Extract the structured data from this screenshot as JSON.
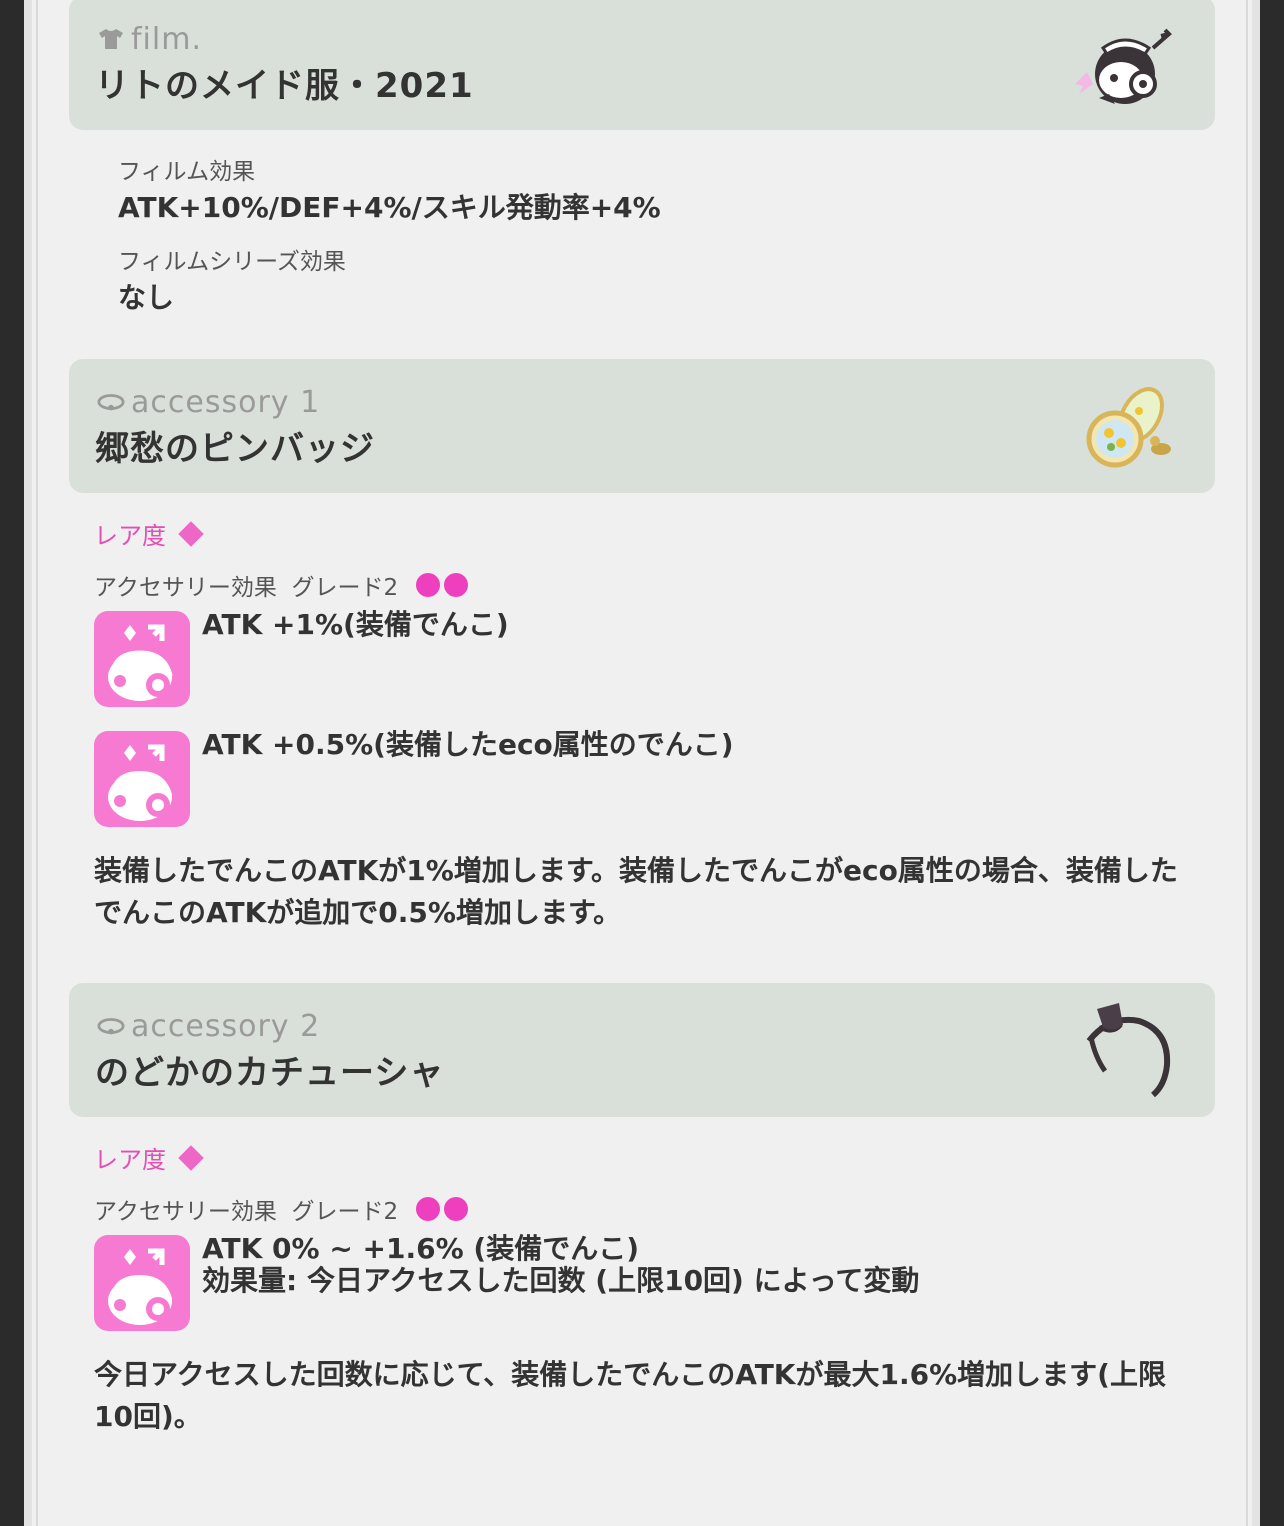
{
  "film": {
    "kind_label": "film.",
    "kind_icon": "tshirt-icon",
    "title": "リトのメイド服・2021",
    "thumb_icon": "maid-character-icon",
    "effect_label": "フィルム効果",
    "effect_value": "ATK+10%/DEF+4%/スキル発動率+4%",
    "series_label": "フィルムシリーズ効果",
    "series_value": "なし"
  },
  "accessory1": {
    "kind_label": "accessory 1",
    "kind_icon": "accessory-icon",
    "title": "郷愁のピンバッジ",
    "thumb_icon": "sunflower-pin-badge-icon",
    "rarity_label": "レア度",
    "grade_label": "アクセサリー効果  グレード2",
    "effects": [
      {
        "text": "ATK +1%(装備でんこ)"
      },
      {
        "text": "ATK +0.5%(装備したeco属性のでんこ)"
      }
    ],
    "description": "装備したでんこのATKが1%増加します。装備したでんこがeco属性の場合、装備したでんこのATKが追加で0.5%増加します。"
  },
  "accessory2": {
    "kind_label": "accessory 2",
    "kind_icon": "accessory-icon",
    "title": "のどかのカチューシャ",
    "thumb_icon": "headband-icon",
    "rarity_label": "レア度",
    "grade_label": "アクセサリー効果  グレード2",
    "effects": [
      {
        "line1": "ATK 0% ~ +1.6% (装備でんこ)",
        "line2": "効果量: 今日アクセスした回数 (上限10回) によって変動"
      }
    ],
    "description": "今日アクセスした回数に応じて、装備したでんこのATKが最大1.6%増加します(上限10回)。"
  },
  "colors": {
    "panel_bg": "#f0f0f0",
    "card_header_bg": "#d9e0da",
    "rarity_pink": "#e34fb4",
    "grade_dot": "#ee3fbf",
    "effect_icon_bg": "#f77ad2"
  }
}
